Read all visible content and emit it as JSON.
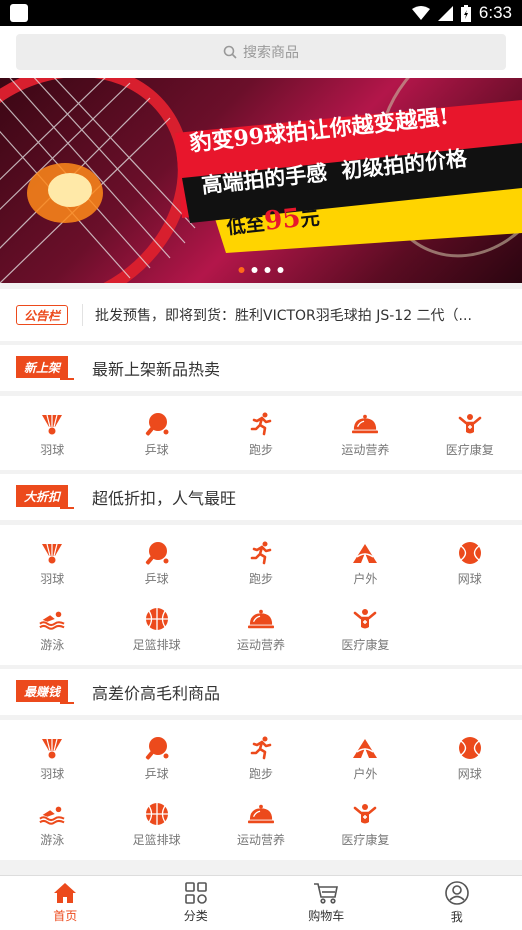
{
  "status_bar": {
    "time": "6:33"
  },
  "search": {
    "placeholder": "搜索商品"
  },
  "banner": {
    "line1": "豹变99球拍让你越变越强!",
    "line2": "高端拍的手感  初级拍的价格",
    "line3_prefix": "低至",
    "line3_price": "95",
    "line3_suffix": "元",
    "dots": 4,
    "active_dot": 0
  },
  "notice": {
    "tag": "公告栏",
    "text": "批发预售，即将到货：胜利VICTOR羽毛球拍 JS-12 二代（..."
  },
  "sections": [
    {
      "badge": "新上架",
      "title": "最新上架新品热卖",
      "items": [
        {
          "label": "羽球",
          "icon": "shuttlecock-icon"
        },
        {
          "label": "乒球",
          "icon": "pingpong-icon"
        },
        {
          "label": "跑步",
          "icon": "running-icon"
        },
        {
          "label": "运动营养",
          "icon": "nutrition-icon"
        },
        {
          "label": "医疗康复",
          "icon": "rehab-icon"
        }
      ]
    },
    {
      "badge": "大折扣",
      "title": "超低折扣，人气最旺",
      "items": [
        {
          "label": "羽球",
          "icon": "shuttlecock-icon"
        },
        {
          "label": "乒球",
          "icon": "pingpong-icon"
        },
        {
          "label": "跑步",
          "icon": "running-icon"
        },
        {
          "label": "户外",
          "icon": "outdoor-icon"
        },
        {
          "label": "网球",
          "icon": "tennis-icon"
        },
        {
          "label": "游泳",
          "icon": "swimming-icon"
        },
        {
          "label": "足篮排球",
          "icon": "ball-icon"
        },
        {
          "label": "运动营养",
          "icon": "nutrition-icon"
        },
        {
          "label": "医疗康复",
          "icon": "rehab-icon"
        }
      ]
    },
    {
      "badge": "最赚钱",
      "title": "高差价高毛利商品",
      "items": [
        {
          "label": "羽球",
          "icon": "shuttlecock-icon"
        },
        {
          "label": "乒球",
          "icon": "pingpong-icon"
        },
        {
          "label": "跑步",
          "icon": "running-icon"
        },
        {
          "label": "户外",
          "icon": "outdoor-icon"
        },
        {
          "label": "网球",
          "icon": "tennis-icon"
        },
        {
          "label": "游泳",
          "icon": "swimming-icon"
        },
        {
          "label": "足篮排球",
          "icon": "ball-icon"
        },
        {
          "label": "运动营养",
          "icon": "nutrition-icon"
        },
        {
          "label": "医疗康复",
          "icon": "rehab-icon"
        }
      ]
    }
  ],
  "tabbar": [
    {
      "label": "首页",
      "icon": "home-icon",
      "active": true
    },
    {
      "label": "分类",
      "icon": "category-icon",
      "active": false
    },
    {
      "label": "购物车",
      "icon": "cart-icon",
      "active": false
    },
    {
      "label": "我",
      "icon": "user-icon",
      "active": false
    }
  ],
  "colors": {
    "accent": "#ec4a1c",
    "banner_red": "#e8162c",
    "banner_yellow": "#ffd400"
  }
}
